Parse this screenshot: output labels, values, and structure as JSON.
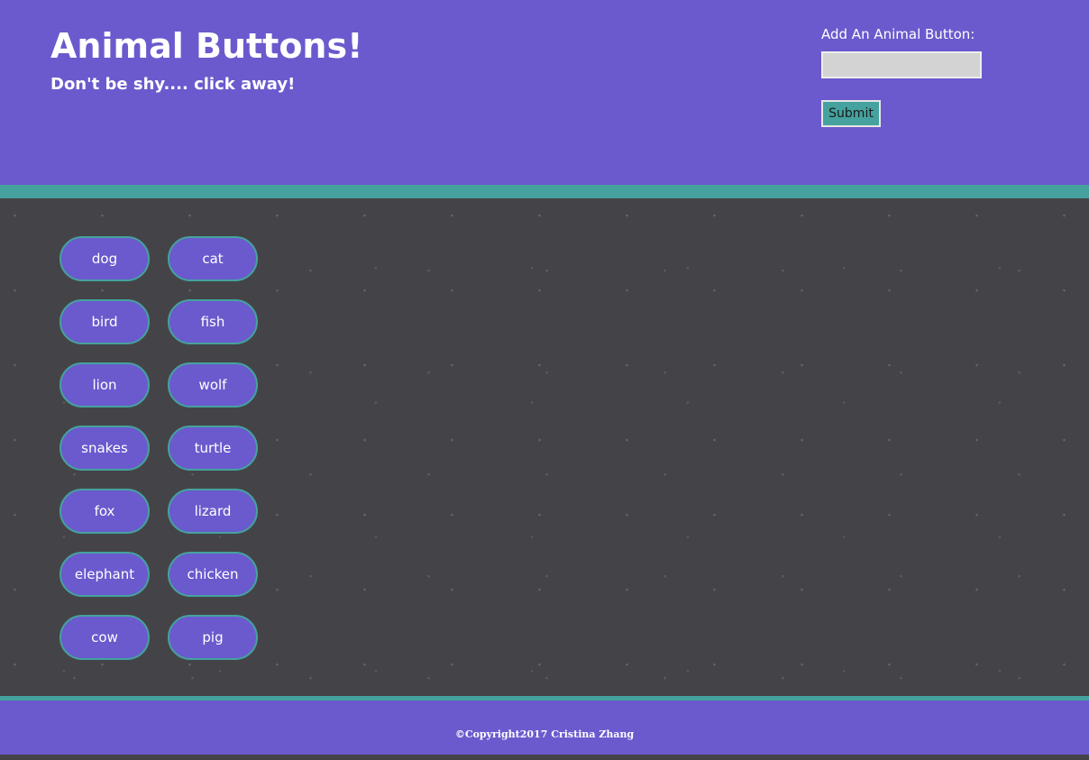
{
  "header": {
    "title": "Animal Buttons!",
    "subtitle": "Don't be shy.... click away!"
  },
  "add_form": {
    "label": "Add An Animal Button:",
    "input_value": "",
    "submit_label": "Submit"
  },
  "animals": [
    "dog",
    "cat",
    "bird",
    "fish",
    "lion",
    "wolf",
    "snakes",
    "turtle",
    "fox",
    "lizard",
    "elephant",
    "chicken",
    "cow",
    "pig"
  ],
  "footer": {
    "copyright": "©Copyright2017 Cristina Zhang"
  },
  "colors": {
    "primary": "#6a5acd",
    "accent": "#45a29e",
    "background": "#444448"
  }
}
